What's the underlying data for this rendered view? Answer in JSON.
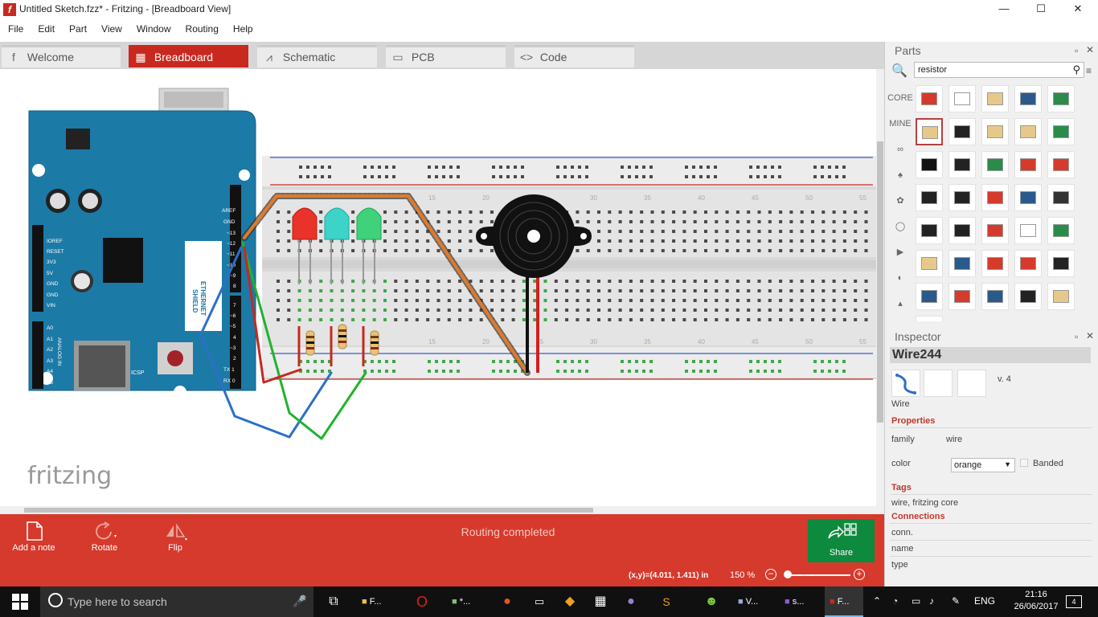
{
  "window": {
    "title": "Untitled Sketch.fzz* - Fritzing - [Breadboard View]",
    "app_icon_letter": "f",
    "controls": {
      "minimize": "—",
      "maximize": "☐",
      "close": "✕"
    }
  },
  "menu": [
    "File",
    "Edit",
    "Part",
    "View",
    "Window",
    "Routing",
    "Help"
  ],
  "tabs": [
    {
      "label": "Welcome",
      "icon": "f"
    },
    {
      "label": "Breadboard",
      "icon": "▦"
    },
    {
      "label": "Schematic",
      "icon": "⩘"
    },
    {
      "label": "PCB",
      "icon": "▭"
    },
    {
      "label": "Code",
      "icon": "<>"
    }
  ],
  "canvas": {
    "watermark": "fritzing",
    "arduino": {
      "shield_text": [
        "ETHERNET",
        "SHIELD"
      ],
      "pin_labels_right": [
        "AREF",
        "GND",
        "~13",
        "~12",
        "~11",
        "~10",
        "~9",
        "8",
        "7",
        "~6",
        "~5",
        "4",
        "~3",
        "2",
        "TX 1",
        "RX 0"
      ],
      "pin_labels_left": [
        "IOREF",
        "RESET",
        "3V3",
        "5V",
        "GND",
        "GND",
        "VIN"
      ],
      "analog_labels": [
        "A0",
        "A1",
        "A2",
        "A3",
        "A4",
        "A5"
      ],
      "icsp": "ICSP",
      "analog_in": "ANALOG IN",
      "digital": "DIGITAL (PWM~)"
    },
    "breadboard_numbers": [
      "15",
      "20",
      "25",
      "30",
      "35",
      "40",
      "45",
      "50",
      "55"
    ],
    "led_colors": [
      "#e8322a",
      "#3ed3c9",
      "#3fd27a"
    ],
    "wire_colors": {
      "orange": "#e07a2a",
      "green": "#22b22e",
      "blue": "#2c6fc9",
      "red": "#c8281f"
    }
  },
  "toolbar": {
    "add_note": "Add a note",
    "rotate": "Rotate",
    "flip": "Flip",
    "routing_status": "Routing completed",
    "share": "Share"
  },
  "status": {
    "coords": "(x,y)=(4.011, 1.411) in",
    "zoom": "150 %"
  },
  "parts_panel": {
    "title": "Parts",
    "search_value": "resistor",
    "bins": [
      "CORE",
      "MINE"
    ]
  },
  "inspector": {
    "title": "Inspector",
    "part_title": "Wire244",
    "version": "v. 4",
    "part_name": "Wire",
    "properties_header": "Properties",
    "family_label": "family",
    "family_value": "wire",
    "color_label": "color",
    "color_value": "orange",
    "banded_label": "Banded",
    "tags_header": "Tags",
    "tags_value": "wire, fritzing core",
    "connections_header": "Connections",
    "conn_label": "conn.",
    "name_label": "name",
    "type_label": "type"
  },
  "taskbar": {
    "search_placeholder": "Type here to search",
    "apps": [
      "F...",
      "*...",
      "V...",
      "s...",
      "F..."
    ],
    "language": "ENG",
    "time": "21:16",
    "date": "26/06/2017",
    "notification_count": "4"
  },
  "accent": "#d63a2c"
}
